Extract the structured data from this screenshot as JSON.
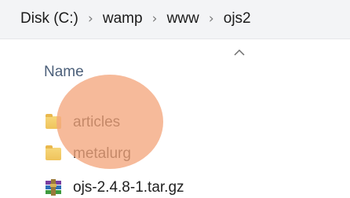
{
  "breadcrumb": {
    "items": [
      "Disk (C:)",
      "wamp",
      "www",
      "ojs2"
    ],
    "separator": "›"
  },
  "list": {
    "column_header": "Name",
    "sort_icon": "chevron-up-icon",
    "rows": [
      {
        "name": "articles",
        "icon": "folder-icon"
      },
      {
        "name": "metalurg",
        "icon": "folder-icon"
      },
      {
        "name": "ojs-2.4.8-1.tar.gz",
        "icon": "winrar-archive-icon"
      }
    ]
  },
  "colors": {
    "address_bar_bg": "#f3f4f6",
    "header_text": "#4c607a",
    "highlight": "#f4a67e",
    "folder": "#efc35b"
  }
}
